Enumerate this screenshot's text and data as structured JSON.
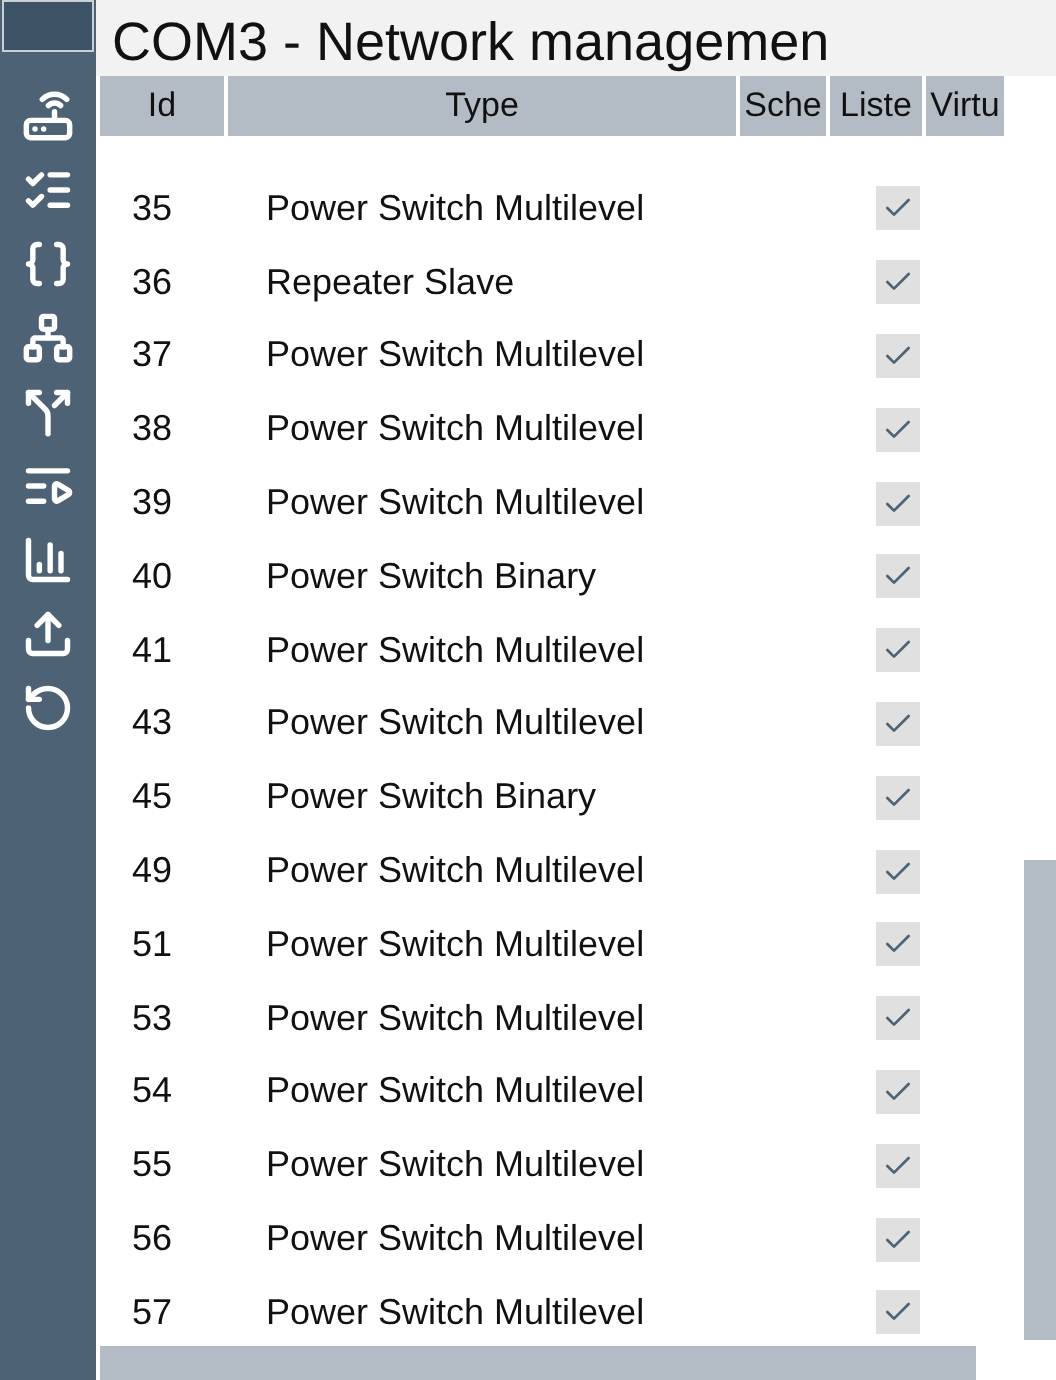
{
  "window": {
    "title": "COM3  - Network managemen"
  },
  "table": {
    "columns": [
      "Id",
      "Type",
      "Sche",
      "Liste",
      "Virtu"
    ],
    "rows": [
      {
        "id": "35",
        "type": "Power Switch Multilevel",
        "listening": true
      },
      {
        "id": "36",
        "type": "Repeater Slave",
        "listening": true
      },
      {
        "id": "37",
        "type": "Power Switch Multilevel",
        "listening": true
      },
      {
        "id": "38",
        "type": "Power Switch Multilevel",
        "listening": true
      },
      {
        "id": "39",
        "type": "Power Switch Multilevel",
        "listening": true
      },
      {
        "id": "40",
        "type": "Power Switch Binary",
        "listening": true
      },
      {
        "id": "41",
        "type": "Power Switch Multilevel",
        "listening": true
      },
      {
        "id": "43",
        "type": "Power Switch Multilevel",
        "listening": true
      },
      {
        "id": "45",
        "type": "Power Switch Binary",
        "listening": true
      },
      {
        "id": "49",
        "type": "Power Switch Multilevel",
        "listening": true
      },
      {
        "id": "51",
        "type": "Power Switch Multilevel",
        "listening": true
      },
      {
        "id": "53",
        "type": "Power Switch Multilevel",
        "listening": true
      },
      {
        "id": "54",
        "type": "Power Switch Multilevel",
        "listening": true
      },
      {
        "id": "55",
        "type": "Power Switch Multilevel",
        "listening": true
      },
      {
        "id": "56",
        "type": "Power Switch Multilevel",
        "listening": true
      },
      {
        "id": "57",
        "type": "Power Switch Multilevel",
        "listening": true
      }
    ]
  }
}
